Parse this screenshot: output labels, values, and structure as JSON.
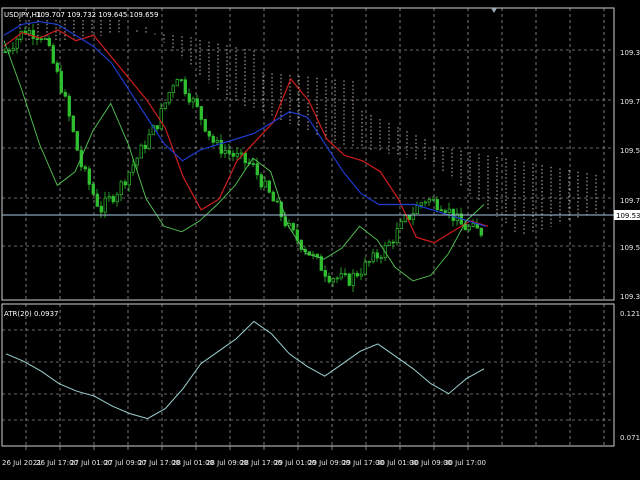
{
  "header": {
    "symbol_label": "USDJPY,H1",
    "ohlc": "109.707 109.732 109.645 109.659",
    "indicator_label": "ATR(20) 0.0937"
  },
  "colors": {
    "background": "#000000",
    "grid": "#c8c8c8",
    "candle": "#2fbf2f",
    "line_red": "#d21e1e",
    "line_blue": "#1e3cd2",
    "line_green": "#55c855",
    "cloud": "#ffe6dc",
    "atr_line": "#9cd2d2",
    "current_price_line": "#aac8e6"
  },
  "chart_data": {
    "type": "line",
    "price_axis": {
      "ticks": [
        "109.315",
        "109.730",
        "109.525",
        "109.730",
        "109.533",
        "109.540",
        "109.345"
      ],
      "current_price": "109.533",
      "ylim": [
        109.33,
        110.4
      ]
    },
    "atr_axis": {
      "ticks": [
        "0.1211",
        "0.0716"
      ],
      "ylim": [
        0.068,
        0.125
      ]
    },
    "time_axis": {
      "labels": [
        "26 Jul 2021",
        "26 Jul 17:00",
        "27 Jul 01:00",
        "27 Jul 09:00",
        "27 Jul 17:00",
        "28 Jul 01:00",
        "28 Jul 09:00",
        "28 Jul 17:00",
        "29 Jul 01:00",
        "29 Jul 09:00",
        "29 Jul 17:00",
        "30 Jul 01:00",
        "30 Jul 09:00",
        "30 Jul 17:00"
      ]
    },
    "series": [
      {
        "values": [
          110.26,
          110.31,
          110.29,
          110.32,
          110.28,
          110.3,
          110.22,
          110.14,
          110.06,
          109.96,
          109.78,
          109.66,
          109.7,
          109.84,
          109.91,
          109.98,
          110.14,
          110.06,
          109.92,
          109.86,
          109.84,
          109.8,
          109.7,
          109.56,
          109.54,
          109.58,
          109.62,
          109.6
        ]
      },
      {
        "values": [
          110.3,
          110.34,
          110.35,
          110.34,
          110.3,
          110.26,
          110.2,
          110.1,
          110.0,
          109.9,
          109.84,
          109.88,
          109.9,
          109.92,
          109.94,
          109.98,
          110.02,
          110.0,
          109.9,
          109.8,
          109.72,
          109.68,
          109.68,
          109.68,
          109.66,
          109.64,
          109.62,
          109.6
        ]
      },
      {
        "values": [
          110.28,
          110.1,
          109.9,
          109.75,
          109.8,
          109.95,
          110.05,
          109.9,
          109.7,
          109.6,
          109.58,
          109.62,
          109.68,
          109.75,
          109.85,
          109.8,
          109.6,
          109.5,
          109.48,
          109.52,
          109.6,
          109.55,
          109.45,
          109.4,
          109.42,
          109.5,
          109.62,
          109.68
        ]
      },
      {
        "values": [
          0.105,
          0.102,
          0.098,
          0.093,
          0.09,
          0.088,
          0.084,
          0.081,
          0.079,
          0.083,
          0.091,
          0.101,
          0.106,
          0.111,
          0.118,
          0.113,
          0.105,
          0.1,
          0.096,
          0.101,
          0.106,
          0.109,
          0.104,
          0.099,
          0.093,
          0.089,
          0.095,
          0.099
        ]
      }
    ],
    "close_series": [
      110.24,
      110.32,
      110.3,
      110.1,
      109.82,
      109.66,
      109.74,
      109.86,
      109.98,
      110.16,
      110.04,
      109.9,
      109.86,
      109.82,
      109.7,
      109.58,
      109.5,
      109.42,
      109.4,
      109.46,
      109.52,
      109.62,
      109.7,
      109.68,
      109.6,
      109.58
    ]
  }
}
